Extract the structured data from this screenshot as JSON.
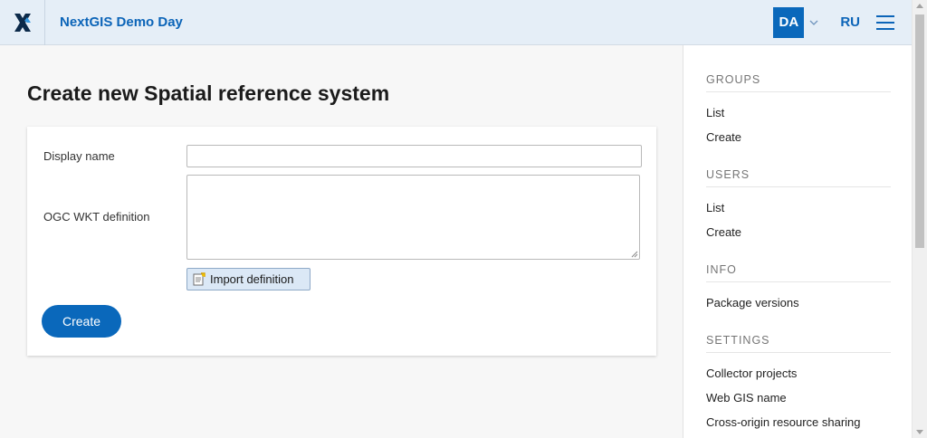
{
  "header": {
    "logo_icon": "nextgis-x-logo-icon",
    "title": "NextGIS Demo Day",
    "avatar_initials": "DA",
    "language": "RU",
    "menu_icon": "hamburger-menu-icon"
  },
  "main": {
    "page_title": "Create new Spatial reference system",
    "form": {
      "display_name_label": "Display name",
      "display_name_value": "",
      "wkt_label": "OGC WKT definition",
      "wkt_value": "",
      "import_button": "Import definition",
      "create_button": "Create"
    }
  },
  "sidebar": {
    "sections": [
      {
        "title": "GROUPS",
        "links": [
          "List",
          "Create"
        ]
      },
      {
        "title": "USERS",
        "links": [
          "List",
          "Create"
        ]
      },
      {
        "title": "INFO",
        "links": [
          "Package versions"
        ]
      },
      {
        "title": "SETTINGS",
        "links": [
          "Collector projects",
          "Web GIS name",
          "Cross-origin resource sharing"
        ]
      }
    ]
  },
  "colors": {
    "accent": "#0a68bb",
    "header_bg": "#e5eef7",
    "page_bg": "#f7f7f7"
  }
}
